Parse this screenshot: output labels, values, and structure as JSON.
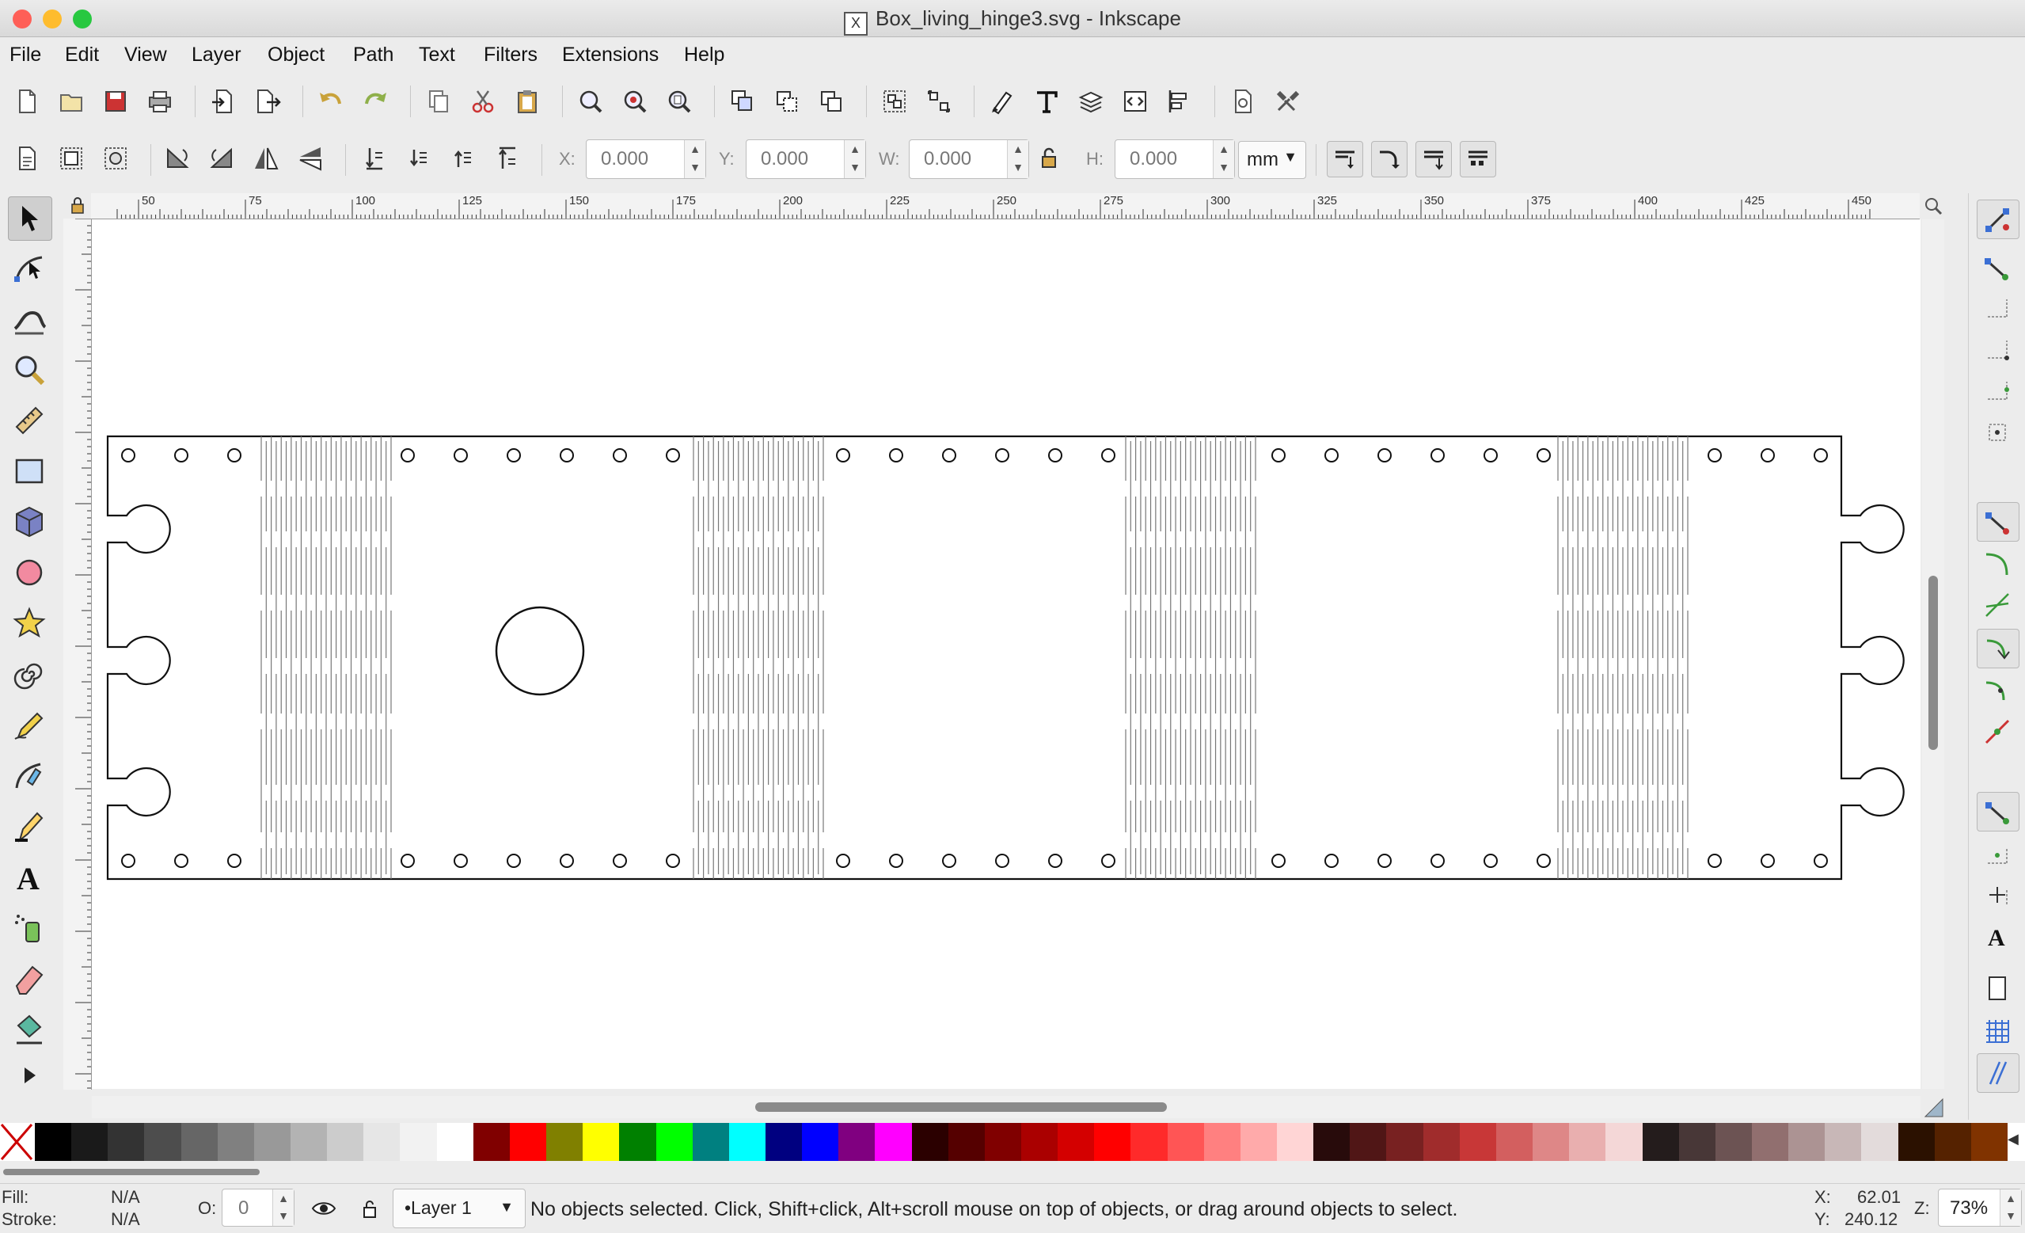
{
  "window": {
    "title": "Box_living_hinge3.svg - Inkscape",
    "title_icon": "x11-icon",
    "controls": [
      {
        "name": "close",
        "color": "#fe5f57"
      },
      {
        "name": "minimize",
        "color": "#febc2e"
      },
      {
        "name": "zoom",
        "color": "#28c840"
      }
    ]
  },
  "menu": [
    "File",
    "Edit",
    "View",
    "Layer",
    "Object",
    "Path",
    "Text",
    "Filters",
    "Extensions",
    "Help"
  ],
  "commands_bar": [
    "new-document-icon",
    "open-icon",
    "save-icon",
    "print-icon",
    "import-icon",
    "export-icon",
    "undo-icon",
    "redo-icon",
    "copy-icon",
    "cut-icon",
    "paste-icon",
    "zoom-selection-icon",
    "zoom-drawing-icon",
    "zoom-page-icon",
    "duplicate-icon",
    "clone-icon",
    "unlink-clone-icon",
    "group-icon",
    "ungroup-icon",
    "xml-editor-icon",
    "text-font-icon",
    "layers-icon",
    "xml-icon",
    "align-icon",
    "document-properties-icon",
    "preferences-icon"
  ],
  "selector_bar": {
    "x": {
      "label": "X:",
      "value": "0.000"
    },
    "y": {
      "label": "Y:",
      "value": "0.000"
    },
    "w": {
      "label": "W:",
      "value": "0.000"
    },
    "h": {
      "label": "H:",
      "value": "0.000"
    },
    "unit": "mm"
  },
  "ruler_labels": [
    "50",
    "75",
    "100",
    "125",
    "150",
    "175",
    "200",
    "225",
    "250",
    "275",
    "300",
    "325",
    "350",
    "375",
    "400",
    "425",
    "450"
  ],
  "tools": [
    "selector-tool-icon",
    "node-tool-icon",
    "tweak-tool-icon",
    "zoom-tool-icon",
    "measure-tool-icon",
    "rectangle-tool-icon",
    "3d-box-tool-icon",
    "ellipse-tool-icon",
    "star-tool-icon",
    "spiral-tool-icon",
    "pencil-tool-icon",
    "pen-tool-icon",
    "calligraphy-tool-icon",
    "text-tool-icon",
    "spray-tool-icon",
    "eraser-tool-icon",
    "paint-bucket-tool-icon",
    "more-tools-icon"
  ],
  "palette_colors": [
    "#000000",
    "#1a1a1a",
    "#333333",
    "#4d4d4d",
    "#666666",
    "#808080",
    "#999999",
    "#b3b3b3",
    "#cccccc",
    "#e6e6e6",
    "#f2f2f2",
    "#ffffff",
    "#800000",
    "#ff0000",
    "#808000",
    "#ffff00",
    "#008000",
    "#00ff00",
    "#008080",
    "#00ffff",
    "#000080",
    "#0000ff",
    "#800080",
    "#ff00ff",
    "#2b0000",
    "#550000",
    "#800000",
    "#aa0000",
    "#d40000",
    "#ff0000",
    "#ff2a2a",
    "#ff5555",
    "#ff8080",
    "#ffaaaa",
    "#ffd5d5",
    "#280b0b",
    "#501616",
    "#782121",
    "#a02c2c",
    "#c83737",
    "#d35f5f",
    "#de8787",
    "#e9afaf",
    "#f4d7d7",
    "#241c1c",
    "#483737",
    "#6c5353",
    "#916f6f",
    "#ac9393",
    "#c8b7b7",
    "#e3dbdb",
    "#2b1100",
    "#552200",
    "#803300"
  ],
  "status": {
    "fill_label": "Fill:",
    "fill_value": "N/A",
    "stroke_label": "Stroke:",
    "stroke_value": "N/A",
    "opacity_label": "O:",
    "opacity_value": "0",
    "layer": "•Layer 1",
    "message": "No objects selected. Click, Shift+click, Alt+scroll mouse on top of objects, or drag around objects to select.",
    "cursor_x_label": "X:",
    "cursor_x": "62.01",
    "cursor_y_label": "Y:",
    "cursor_y": "240.12",
    "zoom_label": "Z:",
    "zoom": "73%"
  }
}
